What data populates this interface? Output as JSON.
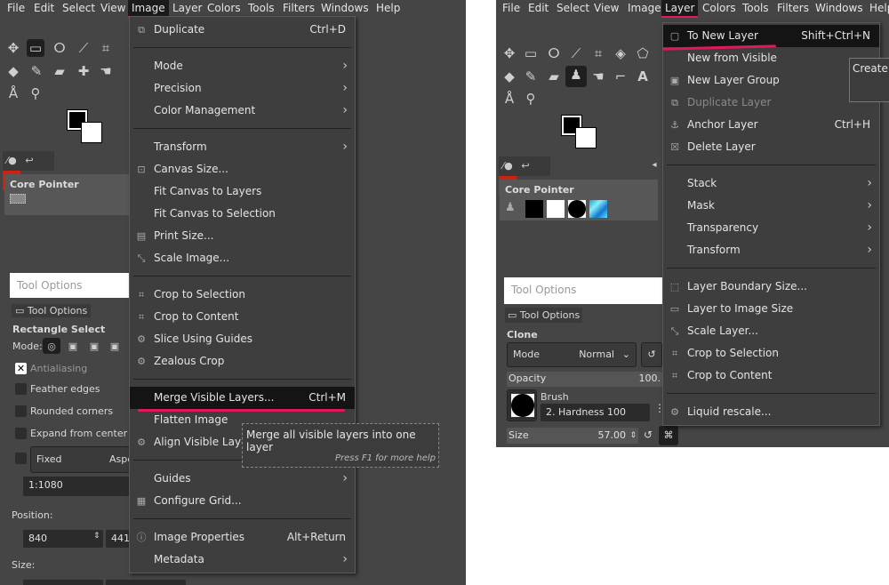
{
  "left": {
    "menubar": [
      "File",
      "Edit",
      "Select",
      "View",
      "Image",
      "Layer",
      "Colors",
      "Tools",
      "Filters",
      "Windows",
      "Help"
    ],
    "active_menu": "Image",
    "menu": [
      {
        "label": "Duplicate",
        "shortcut": "Ctrl+D",
        "icon": "duplicate-icon"
      },
      {
        "sep": true
      },
      {
        "label": "Mode",
        "submenu": true
      },
      {
        "label": "Precision",
        "submenu": true
      },
      {
        "label": "Color Management",
        "submenu": true
      },
      {
        "sep": true
      },
      {
        "label": "Transform",
        "submenu": true
      },
      {
        "label": "Canvas Size...",
        "icon": "canvas-size-icon"
      },
      {
        "label": "Fit Canvas to Layers"
      },
      {
        "label": "Fit Canvas to Selection"
      },
      {
        "label": "Print Size...",
        "icon": "print-icon"
      },
      {
        "label": "Scale Image...",
        "icon": "scale-icon"
      },
      {
        "sep": true
      },
      {
        "label": "Crop to Selection",
        "icon": "crop-icon"
      },
      {
        "label": "Crop to Content",
        "icon": "crop-icon"
      },
      {
        "label": "Slice Using Guides",
        "icon": "gear-icon"
      },
      {
        "label": "Zealous Crop",
        "icon": "gear-icon"
      },
      {
        "sep": true
      },
      {
        "label": "Merge Visible Layers...",
        "shortcut": "Ctrl+M",
        "highlighted": true
      },
      {
        "label": "Flatten Image"
      },
      {
        "label": "Align Visible Layers...",
        "icon": "gear-icon"
      },
      {
        "sep": true
      },
      {
        "label": "Guides",
        "submenu": true
      },
      {
        "label": "Configure Grid...",
        "icon": "grid-icon"
      },
      {
        "sep": true
      },
      {
        "label": "Image Properties",
        "shortcut": "Alt+Return",
        "icon": "info-icon"
      },
      {
        "label": "Metadata",
        "submenu": true
      }
    ],
    "tooltip": {
      "text": "Merge all visible layers into one layer",
      "help": "Press F1 for more help"
    },
    "core_pointer": "Core Pointer",
    "tool_options_header": "Tool Options",
    "tool_options_tab": "Tool Options",
    "tool_name": "Rectangle Select",
    "mode_label": "Mode:",
    "options": [
      {
        "label": "Antialiasing",
        "checked": true
      },
      {
        "label": "Feather edges",
        "checked": false
      },
      {
        "label": "Rounded corners",
        "checked": false
      },
      {
        "label": "Expand from center",
        "checked": false
      }
    ],
    "fixed": "Fixed",
    "aspect": "Aspect ratio",
    "ratio": "1:1080",
    "position_label": "Position:",
    "pos_x": "840",
    "pos_y": "441",
    "size_label": "Size:"
  },
  "right": {
    "menubar": [
      "File",
      "Edit",
      "Select",
      "View",
      "Image",
      "Layer",
      "Colors",
      "Tools",
      "Filters",
      "Windows",
      "Help"
    ],
    "active_menu": "Layer",
    "menu": [
      {
        "label": "To New Layer",
        "shortcut": "Shift+Ctrl+N",
        "icon": "new-layer-icon",
        "highlighted": true
      },
      {
        "label": "New from Visible"
      },
      {
        "label": "New Layer Group",
        "icon": "layer-group-icon"
      },
      {
        "label": "Duplicate Layer",
        "icon": "duplicate-icon",
        "disabled": true
      },
      {
        "label": "Anchor Layer",
        "shortcut": "Ctrl+H",
        "icon": "anchor-icon"
      },
      {
        "label": "Delete Layer",
        "icon": "delete-icon"
      },
      {
        "sep": true
      },
      {
        "label": "Stack",
        "submenu": true
      },
      {
        "label": "Mask",
        "submenu": true
      },
      {
        "label": "Transparency",
        "submenu": true
      },
      {
        "label": "Transform",
        "submenu": true
      },
      {
        "sep": true
      },
      {
        "label": "Layer Boundary Size...",
        "icon": "boundary-icon"
      },
      {
        "label": "Layer to Image Size",
        "icon": "layer-image-icon"
      },
      {
        "label": "Scale Layer...",
        "icon": "scale-icon"
      },
      {
        "label": "Crop to Selection",
        "icon": "crop-icon"
      },
      {
        "label": "Crop to Content",
        "icon": "crop-icon"
      },
      {
        "sep": true
      },
      {
        "label": "Liquid rescale...",
        "icon": "gear-icon"
      }
    ],
    "tooltip": "Create",
    "core_pointer": "Core Pointer",
    "tool_options_header": "Tool Options",
    "tool_options_tab": "Tool Options",
    "tool_name": "Clone",
    "mode_label": "Mode",
    "mode_value": "Normal",
    "opacity_label": "Opacity",
    "opacity_value": "100.",
    "brush_label": "Brush",
    "brush_value": "2. Hardness 100",
    "size_label": "Size",
    "size_value": "57.00"
  }
}
